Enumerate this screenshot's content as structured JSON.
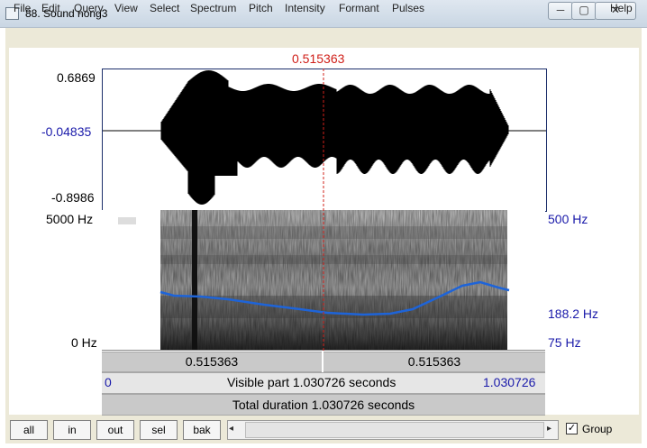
{
  "window": {
    "title": "88. Sound nong3",
    "controls": {
      "minimize": "─",
      "maximize": "▢",
      "close": "✕"
    }
  },
  "menubar": {
    "items": [
      "File",
      "Edit",
      "Query",
      "View",
      "Select",
      "Spectrum",
      "Pitch",
      "Intensity",
      "Formant",
      "Pulses"
    ],
    "help": "Help"
  },
  "cursor": {
    "time_label": "0.515363"
  },
  "waveform": {
    "y_max": "0.6869",
    "y_mid": "-0.04835",
    "y_min": "-0.8986"
  },
  "spectrogram": {
    "freq_max": "5000 Hz",
    "freq_min": "0 Hz",
    "pitch_max": "500 Hz",
    "pitch_value": "188.2 Hz",
    "pitch_min": "75 Hz"
  },
  "bars": {
    "left_selection": "0.515363",
    "right_selection": "0.515363",
    "visible_start": "0",
    "visible_label": "Visible part 1.030726 seconds",
    "visible_end": "1.030726",
    "total_label": "Total duration 1.030726 seconds"
  },
  "toolbar": {
    "buttons": [
      "all",
      "in",
      "out",
      "sel",
      "bak"
    ],
    "group_checked": true,
    "group_label": "Group",
    "scroll_left": "◂",
    "scroll_right": "▸"
  },
  "colors": {
    "cursor": "#d0201a",
    "pitch": "#1e64d8",
    "axis_blue": "#1a1aaa"
  }
}
